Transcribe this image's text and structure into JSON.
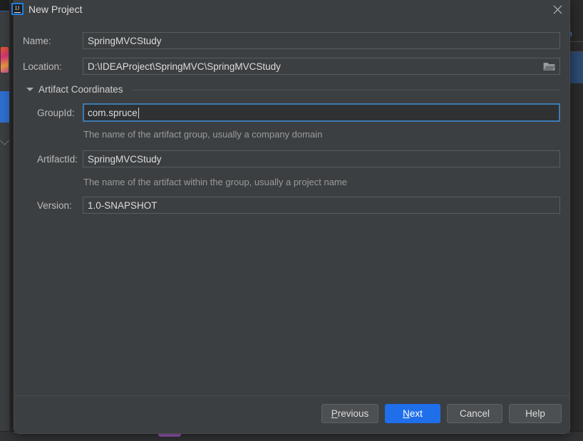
{
  "window": {
    "title": "New Project",
    "logo_icon": "intellij-idea-logo-icon",
    "close_icon": "close-icon"
  },
  "background": {
    "right_tab_text": "n"
  },
  "form": {
    "name": {
      "label": "Name:",
      "value": "SpringMVCStudy"
    },
    "location": {
      "label": "Location:",
      "value": "D:\\IDEAProject\\SpringMVC\\SpringMVCStudy",
      "browse_icon": "folder-icon"
    },
    "section": {
      "title": "Artifact Coordinates",
      "expand_icon": "triangle-down-icon",
      "expanded": true
    },
    "group_id": {
      "label": "GroupId:",
      "value": "com.spruce",
      "hint": "The name of the artifact group, usually a company domain",
      "focused": true
    },
    "artifact_id": {
      "label": "ArtifactId:",
      "value": "SpringMVCStudy",
      "hint": "The name of the artifact within the group, usually a project name"
    },
    "version": {
      "label": "Version:",
      "value": "1.0-SNAPSHOT"
    }
  },
  "footer": {
    "previous": {
      "mnemonic": "P",
      "rest": "revious"
    },
    "next": {
      "pre": "",
      "mnemonic": "N",
      "rest": "ext"
    },
    "cancel": "Cancel",
    "help": "Help"
  },
  "colors": {
    "dialog_bg": "#3c3f41",
    "accent_blue": "#1f6feb",
    "focus_border": "#3d7ab0",
    "text": "#dcdcdc",
    "hint_text": "#9a9a9a"
  }
}
